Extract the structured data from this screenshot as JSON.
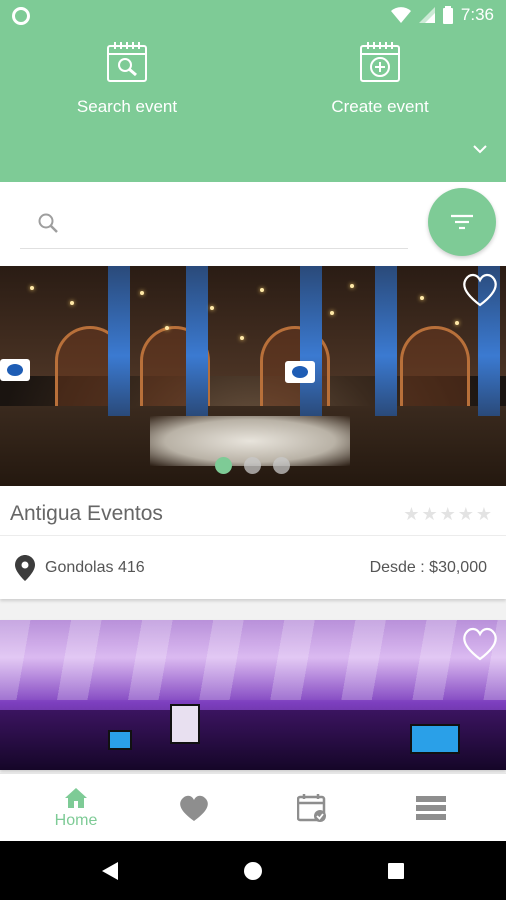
{
  "status_bar": {
    "time": "7:36"
  },
  "header": {
    "search_action": {
      "label": "Search event",
      "icon": "calendar-search-icon"
    },
    "create_action": {
      "label": "Create event",
      "icon": "calendar-add-icon"
    }
  },
  "search": {
    "placeholder": "",
    "value": ""
  },
  "listings": [
    {
      "name": "Antigua Eventos",
      "address": "Gondolas 416",
      "price": "Desde : $30,000",
      "rating": 0,
      "image_count": 3,
      "active_image": 1
    },
    {
      "name": "",
      "address": "",
      "price": ""
    }
  ],
  "bottom_nav": {
    "items": [
      {
        "label": "Home",
        "icon": "home-icon",
        "active": true
      },
      {
        "label": "",
        "icon": "heart-icon"
      },
      {
        "label": "",
        "icon": "calendar-check-icon"
      },
      {
        "label": "",
        "icon": "menu-icon"
      }
    ]
  },
  "colors": {
    "accent": "#7ecb96",
    "star_empty": "#e3e3e3"
  }
}
